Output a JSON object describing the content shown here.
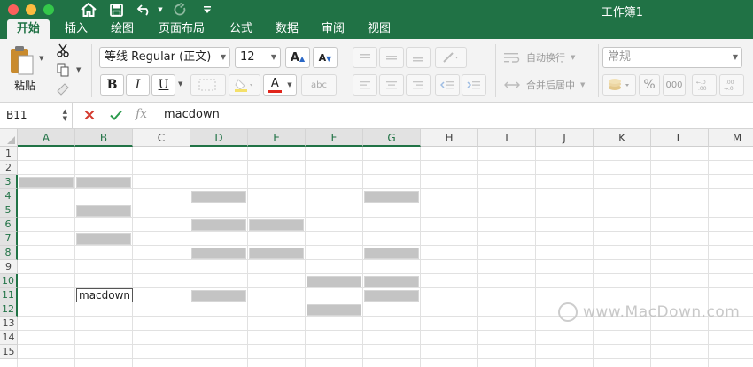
{
  "window": {
    "title": "工作簿1"
  },
  "tabs": [
    {
      "label": "开始",
      "active": true
    },
    {
      "label": "插入"
    },
    {
      "label": "绘图"
    },
    {
      "label": "页面布局"
    },
    {
      "label": "公式"
    },
    {
      "label": "数据"
    },
    {
      "label": "审阅"
    },
    {
      "label": "视图"
    }
  ],
  "ribbon": {
    "paste_label": "粘贴",
    "font_name": "等线 Regular (正文)",
    "font_size": "12",
    "bold": "B",
    "italic": "I",
    "underline": "U",
    "font_color_letter": "A",
    "wrap_text_label": "自动换行",
    "merge_center_label": "合并后居中",
    "number_format": "常规",
    "percent": "%",
    "comma": "000",
    "font_color": "#e1251b"
  },
  "formula_bar": {
    "cell_ref": "B11",
    "fx": "fx",
    "value": "macdown"
  },
  "sheet": {
    "columns": [
      "A",
      "B",
      "C",
      "D",
      "E",
      "F",
      "G",
      "H",
      "I",
      "J",
      "K",
      "L",
      "M"
    ],
    "rows": [
      "1",
      "2",
      "3",
      "4",
      "5",
      "6",
      "7",
      "8",
      "9",
      "10",
      "11",
      "12",
      "13",
      "14",
      "15"
    ],
    "selected_columns": [
      "A",
      "B",
      "D",
      "E",
      "F",
      "G"
    ],
    "selected_rows": [
      "3",
      "4",
      "5",
      "6",
      "7",
      "8",
      "10",
      "11",
      "12"
    ],
    "selected_cells": [
      "A3",
      "B3",
      "D4",
      "G4",
      "B5",
      "D6",
      "E6",
      "B7",
      "D8",
      "E8",
      "G8",
      "F10",
      "G10",
      "D11",
      "G11",
      "F12"
    ],
    "active_cell": {
      "ref": "B11",
      "value": "macdown"
    },
    "selection_color": "#c4c4c4"
  },
  "watermark": {
    "text": "www.MacDown.com"
  }
}
